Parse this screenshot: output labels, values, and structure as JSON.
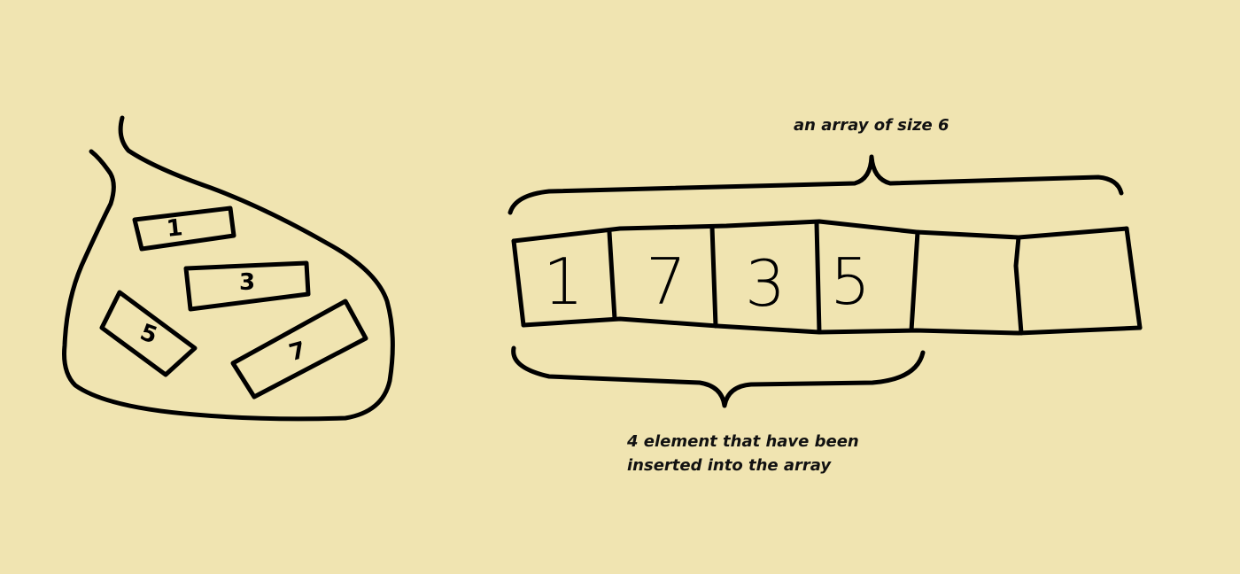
{
  "captions": {
    "array_size": "an array of size 6",
    "inserted_line1": "4 element that have been",
    "inserted_line2": "inserted into the array"
  },
  "bag": {
    "items": [
      {
        "label": "1"
      },
      {
        "label": "3"
      },
      {
        "label": "5"
      },
      {
        "label": "7"
      }
    ]
  },
  "array": {
    "cells": [
      {
        "value": "1"
      },
      {
        "value": "7"
      },
      {
        "value": "3"
      },
      {
        "value": "5"
      },
      {
        "value": ""
      },
      {
        "value": ""
      }
    ]
  },
  "colors": {
    "background": "#f0e4b1",
    "ink": "#000000"
  }
}
